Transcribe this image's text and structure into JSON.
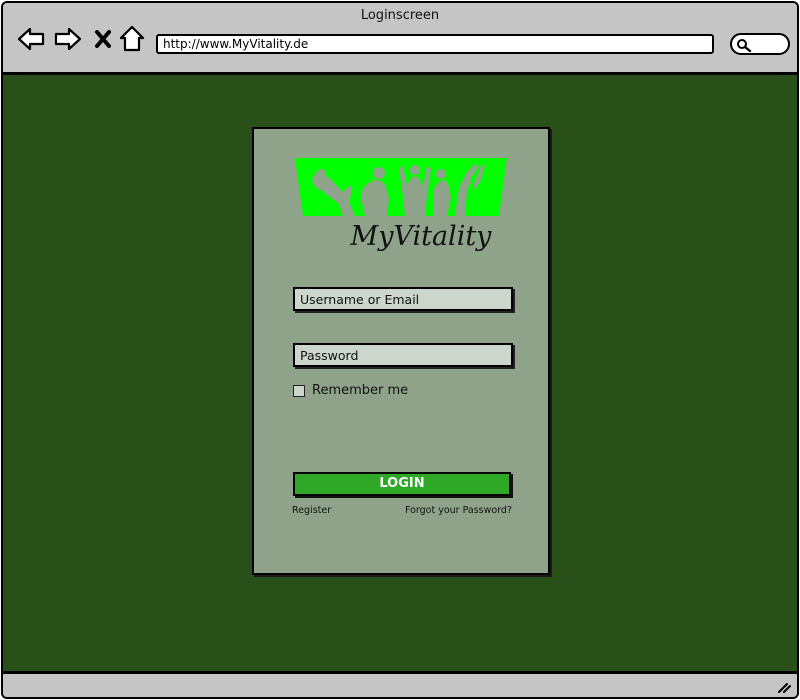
{
  "window": {
    "title": "Loginscreen",
    "url": "http://www.MyVitality.de"
  },
  "nav": {
    "back_icon": "back-arrow-icon",
    "forward_icon": "forward-arrow-icon",
    "stop_icon": "close-icon",
    "home_icon": "home-icon",
    "search_icon": "search-icon"
  },
  "login": {
    "brand": "MyVitality",
    "logo_color": "#00ff00",
    "username_placeholder": "Username or Email",
    "password_placeholder": "Password",
    "remember_label": "Remember me",
    "remember_checked": false,
    "login_label": "LOGIN",
    "register_link": "Register",
    "forgot_link": "Forgot your Password?"
  },
  "colors": {
    "background": "#285018",
    "card": "#8fa38a",
    "button": "#2fa828",
    "chrome": "#c5c5c5"
  }
}
